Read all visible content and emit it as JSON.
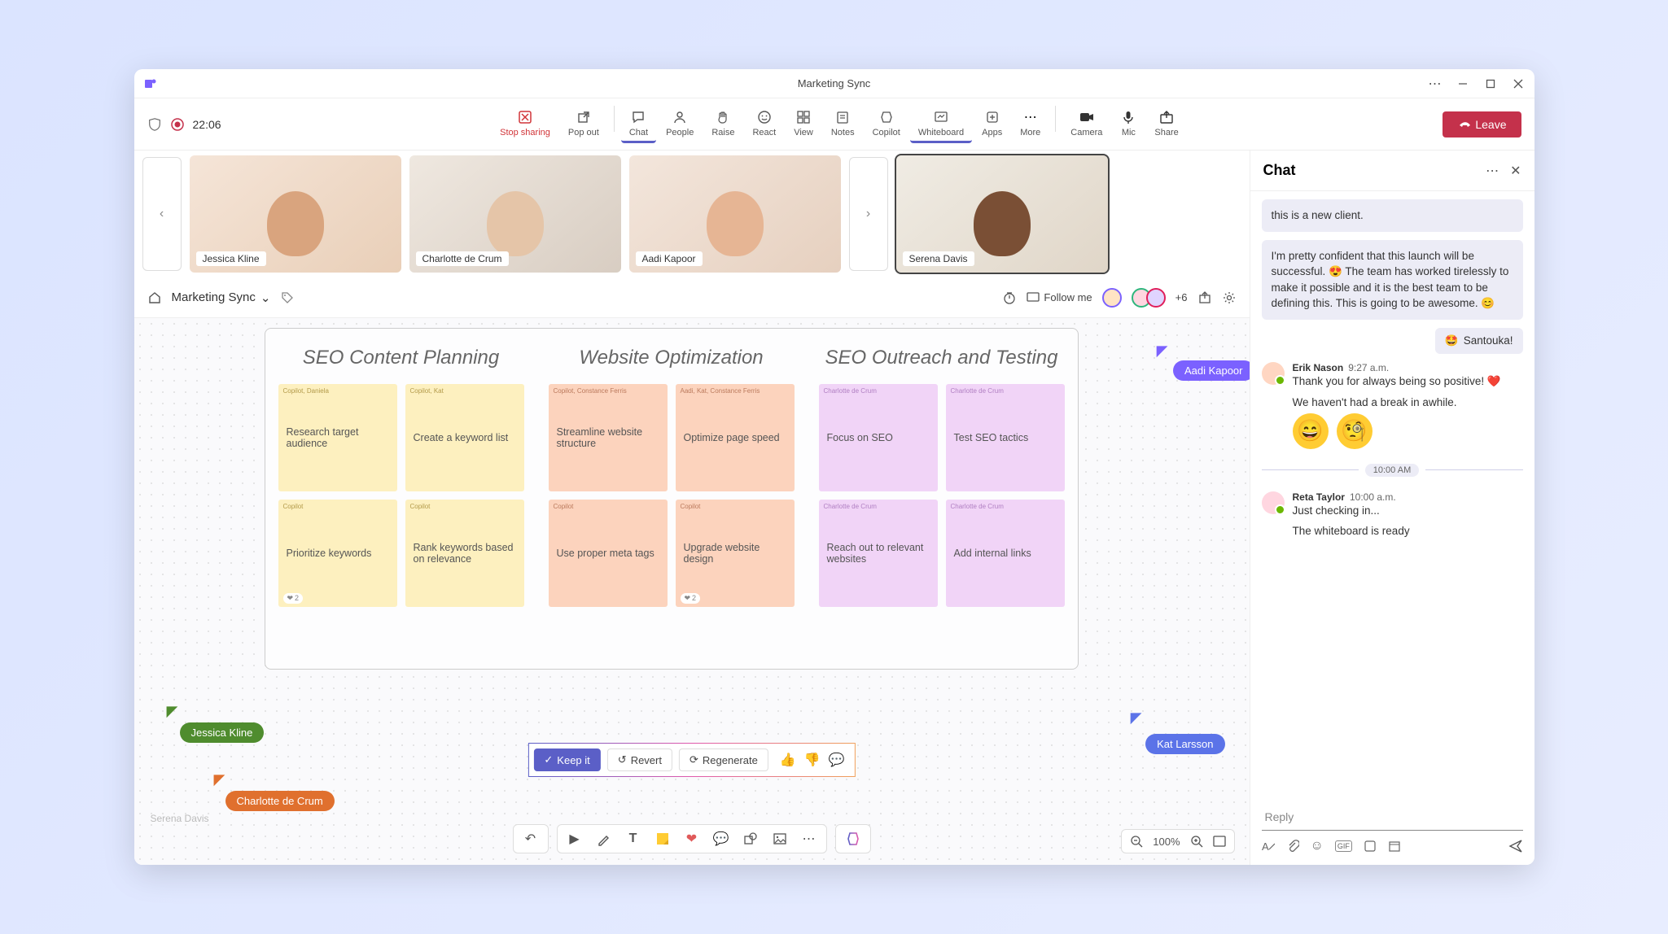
{
  "window": {
    "title": "Marketing Sync"
  },
  "meeting": {
    "timer": "22:06",
    "tools": {
      "stop_sharing": "Stop sharing",
      "pop_out": "Pop out",
      "chat": "Chat",
      "people": "People",
      "raise": "Raise",
      "react": "React",
      "view": "View",
      "notes": "Notes",
      "copilot": "Copilot",
      "whiteboard": "Whiteboard",
      "apps": "Apps",
      "more": "More",
      "camera": "Camera",
      "mic": "Mic",
      "share": "Share"
    },
    "leave": "Leave"
  },
  "participants": [
    {
      "name": "Jessica Kline"
    },
    {
      "name": "Charlotte de Crum"
    },
    {
      "name": "Aadi Kapoor"
    },
    {
      "name": "Serena Davis"
    }
  ],
  "whiteboard": {
    "title": "Marketing Sync",
    "follow": "Follow me",
    "more_count": "+6",
    "columns": [
      {
        "title": "SEO Content Planning",
        "color": "yellow",
        "notes": [
          {
            "author": "Copilot, Daniela",
            "text": "Research target audience"
          },
          {
            "author": "Copilot, Kat",
            "text": "Create a keyword list"
          },
          {
            "author": "Copilot",
            "text": "Prioritize keywords",
            "hearts": 2
          },
          {
            "author": "Copilot",
            "text": "Rank keywords based on relevance"
          }
        ]
      },
      {
        "title": "Website Optimization",
        "color": "orange",
        "notes": [
          {
            "author": "Copilot, Constance Ferris",
            "text": "Streamline website structure"
          },
          {
            "author": "Aadi, Kat, Constance Ferris",
            "text": "Optimize page speed"
          },
          {
            "author": "Copilot",
            "text": "Use proper meta tags"
          },
          {
            "author": "Copilot",
            "text": "Upgrade website design",
            "hearts": 2
          }
        ]
      },
      {
        "title": "SEO Outreach and Testing",
        "color": "pink",
        "notes": [
          {
            "author": "Charlotte de Crum",
            "text": "Focus on SEO"
          },
          {
            "author": "Charlotte de Crum",
            "text": "Test SEO tactics"
          },
          {
            "author": "Charlotte de Crum",
            "text": "Reach out to relevant websites"
          },
          {
            "author": "Charlotte de Crum",
            "text": "Add internal links"
          }
        ]
      }
    ],
    "cursors": {
      "aadi": "Aadi Kapoor",
      "jessica": "Jessica Kline",
      "charlotte": "Charlotte de Crum",
      "kat": "Kat Larsson",
      "serena_faded": "Serena Davis"
    },
    "ai_actions": {
      "keep": "Keep it",
      "revert": "Revert",
      "regen": "Regenerate"
    },
    "zoom": "100%"
  },
  "chat": {
    "title": "Chat",
    "block1_a": "this is a new client.",
    "block1_b": "I'm pretty confident that this launch will be successful. 😍 The team has worked tirelessly to make it possible and it is the best team to be defining this. This is going to be awesome. 😊",
    "reply1": "Santouka!",
    "thread1": {
      "name": "Erik Nason",
      "time": "9:27 a.m.",
      "line1": "Thank you for always being so positive! ❤️",
      "line2": "We haven't had a break in awhile."
    },
    "divider_time": "10:00 AM",
    "thread2": {
      "name": "Reta Taylor",
      "time": "10:00 a.m.",
      "line1": "Just checking in...",
      "line2": "The whiteboard is ready"
    },
    "reply_placeholder": "Reply"
  }
}
